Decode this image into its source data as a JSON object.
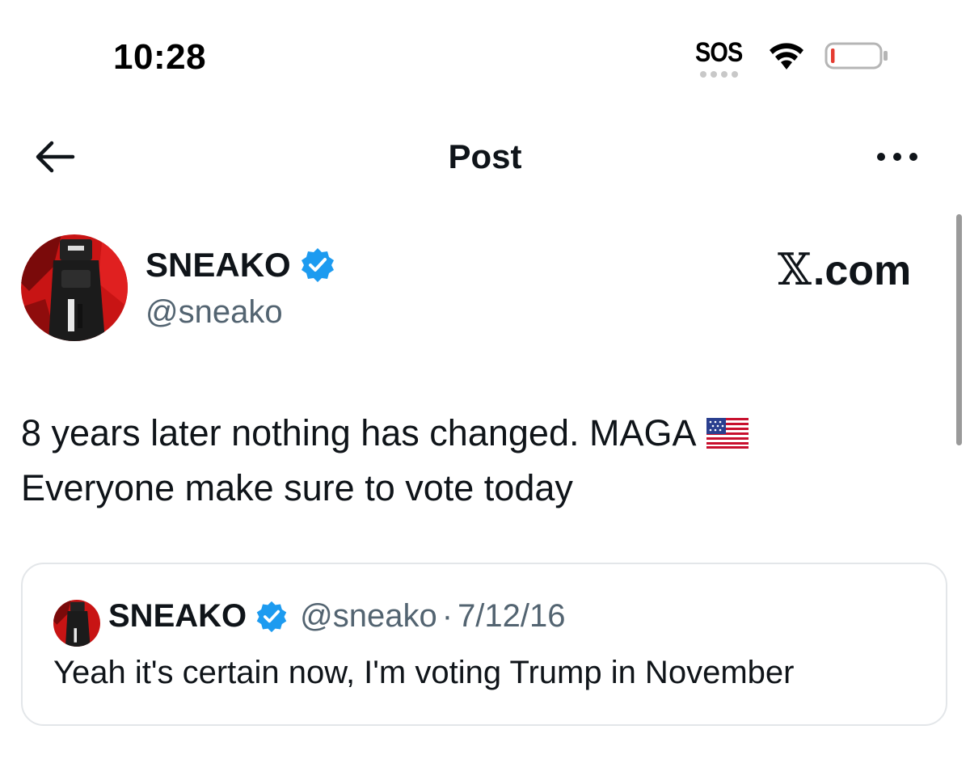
{
  "status_bar": {
    "time": "10:28",
    "sos_label": "SOS",
    "battery_level": 0.08,
    "battery_color": "#e53b30"
  },
  "header": {
    "title": "Post",
    "back_icon": "arrow-left-icon",
    "more_icon": "more-horizontal-icon"
  },
  "post": {
    "author": {
      "name": "SNEAKO",
      "handle": "@sneako",
      "verified": true,
      "verified_color": "#1d9bf0"
    },
    "watermark_text": ".com",
    "watermark_glyph": "𝕏",
    "text_lines": [
      "8 years later nothing has changed. MAGA",
      "Everyone make sure to vote today"
    ],
    "emoji": "us-flag"
  },
  "quoted_post": {
    "author": {
      "name": "SNEAKO",
      "handle": "@sneako",
      "verified": true
    },
    "separator": "·",
    "date": "7/12/16",
    "text": "Yeah it's certain now, I'm voting Trump in November"
  },
  "colors": {
    "text_primary": "#0f1419",
    "text_secondary": "#536471",
    "border": "#e3e6e9",
    "accent": "#1d9bf0"
  }
}
